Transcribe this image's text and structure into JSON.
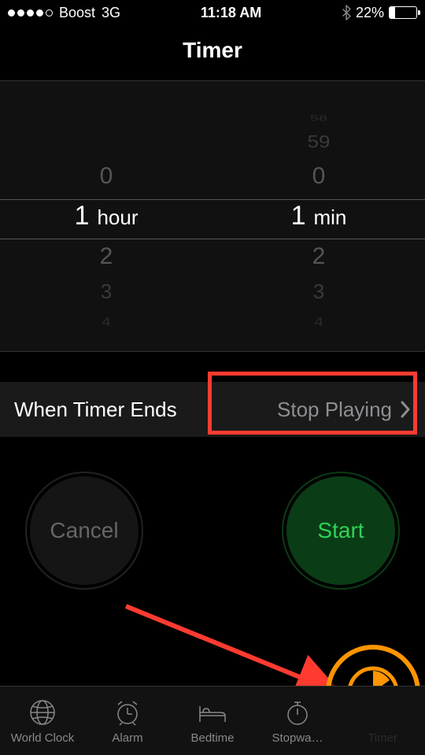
{
  "status": {
    "carrier": "Boost",
    "network": "3G",
    "time": "11:18 AM",
    "battery_pct": "22%",
    "signal_filled": 4,
    "signal_total": 5
  },
  "header": {
    "title": "Timer"
  },
  "picker": {
    "hours": {
      "selected": "1",
      "unit": "hour",
      "above": [
        "0"
      ],
      "below": [
        "2",
        "3",
        "4"
      ]
    },
    "minutes": {
      "selected": "1",
      "unit": "min",
      "above": [
        "0",
        "59",
        "58"
      ],
      "below": [
        "2",
        "3",
        "4"
      ]
    }
  },
  "ends": {
    "label": "When Timer Ends",
    "value": "Stop Playing"
  },
  "buttons": {
    "cancel": "Cancel",
    "start": "Start"
  },
  "tabs": {
    "world_clock": "World Clock",
    "alarm": "Alarm",
    "bedtime": "Bedtime",
    "stopwatch": "Stopwa…",
    "timer": "Timer"
  },
  "colors": {
    "accent_green": "#30d158",
    "accent_orange": "#ff9500",
    "annotation_red": "#ff3b30"
  }
}
